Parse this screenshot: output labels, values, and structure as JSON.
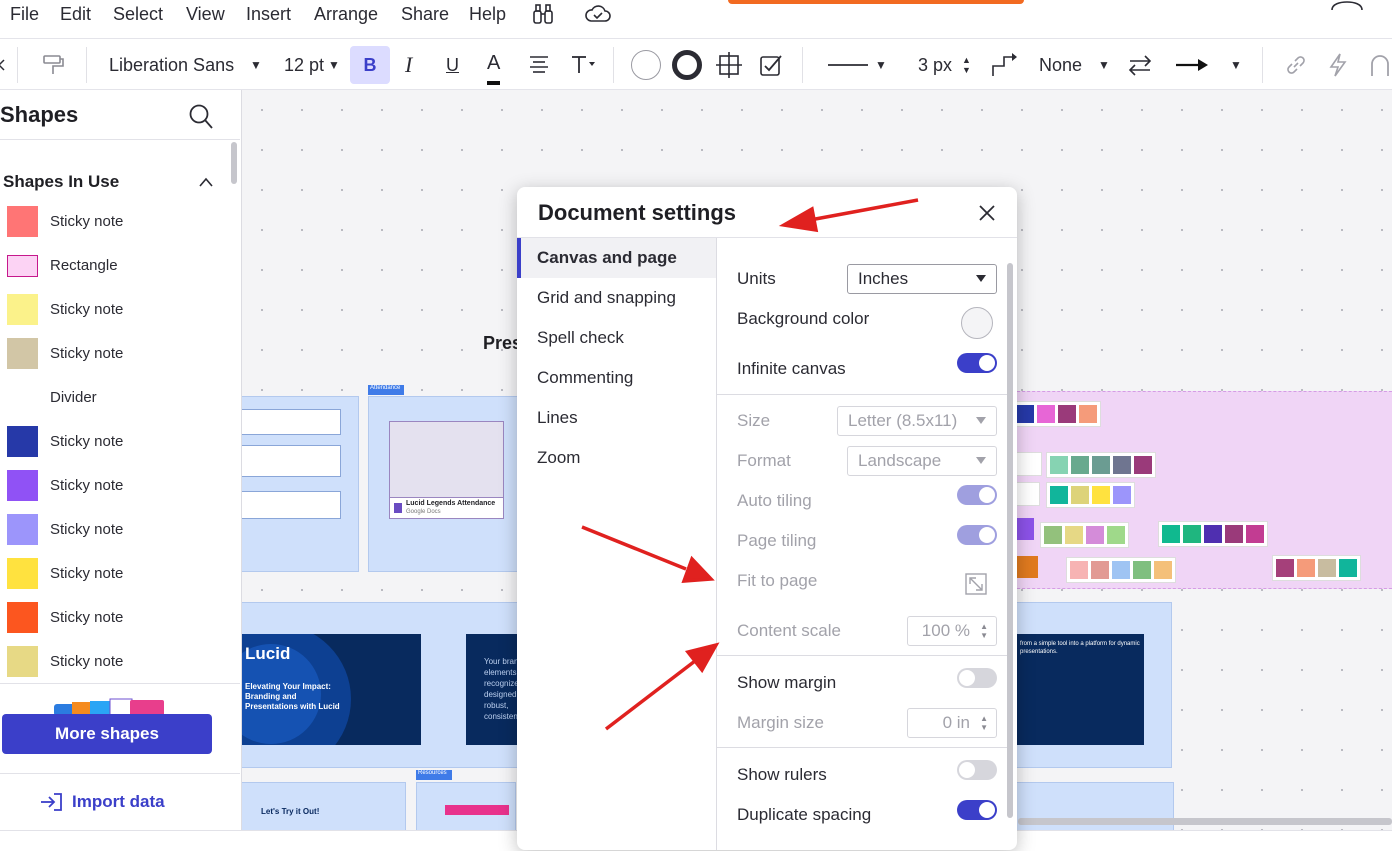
{
  "menu": [
    "File",
    "Edit",
    "Select",
    "View",
    "Insert",
    "Arrange",
    "Share",
    "Help"
  ],
  "toolbar": {
    "font_family": "Liberation Sans",
    "font_size": "12 pt",
    "bold": "B",
    "italic": "I",
    "underline": "U",
    "text_color": "A",
    "line_width": "3 px",
    "line_end": "None"
  },
  "shapes_panel": {
    "title": "Shapes",
    "section_title": "Shapes In Use",
    "items": [
      {
        "label": "Sticky note",
        "color": "#ff7575"
      },
      {
        "label": "Rectangle",
        "color": "#fcd3f4"
      },
      {
        "label": "Sticky note",
        "color": "#fbf28a"
      },
      {
        "label": "Sticky note",
        "color": "#d2c6a6"
      },
      {
        "label": "Divider",
        "color": ""
      },
      {
        "label": "Sticky note",
        "color": "#2639a8"
      },
      {
        "label": "Sticky note",
        "color": "#9052f5"
      },
      {
        "label": "Sticky note",
        "color": "#9c95fb"
      },
      {
        "label": "Sticky note",
        "color": "#ffe23f"
      },
      {
        "label": "Sticky note",
        "color": "#fc561f"
      },
      {
        "label": "Sticky note",
        "color": "#e7d985"
      }
    ],
    "more_shapes": "More shapes",
    "import_data": "Import data"
  },
  "canvas": {
    "lucid_logo": "Lucid",
    "slide_heading": "Elevating Your Impact: Branding and Presentations with Lucid",
    "pres_text": "Pres",
    "try_it": "Let's Try it Out!",
    "attendance_card": "Lucid Legends Attendance",
    "attendance_source": "Google Docs",
    "resources_tag": "Resources",
    "attendance_tag": "Attendance",
    "brand_text": "Your brand elements recognize designed a robust, consistent",
    "slide_right_text": "from a simple tool into a platform for dynamic presentations."
  },
  "dialog": {
    "title": "Document settings",
    "nav": [
      "Canvas and page",
      "Grid and snapping",
      "Spell check",
      "Commenting",
      "Lines",
      "Zoom"
    ],
    "active_nav": "Canvas and page",
    "units_label": "Units",
    "units_value": "Inches",
    "background_color_label": "Background color",
    "infinite_canvas_label": "Infinite canvas",
    "infinite_canvas": true,
    "size_label": "Size",
    "size_value": "Letter (8.5x11)",
    "format_label": "Format",
    "format_value": "Landscape",
    "auto_tiling_label": "Auto tiling",
    "page_tiling_label": "Page tiling",
    "fit_to_page_label": "Fit to page",
    "content_scale_label": "Content scale",
    "content_scale_value": "100 %",
    "show_margin_label": "Show margin",
    "show_margin": false,
    "margin_size_label": "Margin size",
    "margin_size_value": "0 in",
    "show_rulers_label": "Show rulers",
    "show_rulers": false,
    "duplicate_spacing_label": "Duplicate spacing",
    "duplicate_spacing": true
  },
  "colors": {
    "accent": "#3b3fc9",
    "annotation_arrow": "#e0211f"
  }
}
